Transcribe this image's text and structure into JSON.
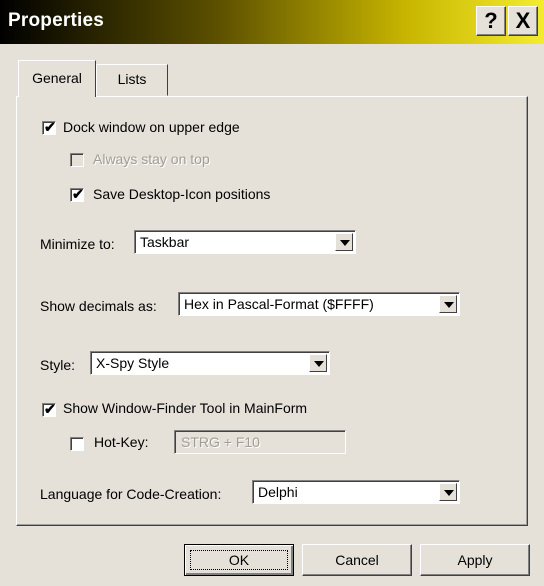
{
  "window": {
    "title": "Properties",
    "help_label": "?",
    "close_label": "X"
  },
  "tabs": [
    {
      "label": "General",
      "active": true
    },
    {
      "label": "Lists",
      "active": false
    }
  ],
  "general": {
    "dock_window": {
      "label": "Dock window on upper edge",
      "checked": true,
      "enabled": true
    },
    "always_on_top": {
      "label": "Always stay on top",
      "checked": false,
      "enabled": false
    },
    "save_icons": {
      "label": "Save Desktop-Icon positions",
      "checked": true,
      "enabled": true
    },
    "minimize_to": {
      "label": "Minimize to:",
      "value": "Taskbar"
    },
    "show_decimals": {
      "label": "Show decimals as:",
      "value": "Hex in Pascal-Format ($FFFF)"
    },
    "style": {
      "label": "Style:",
      "value": "X-Spy Style"
    },
    "show_finder": {
      "label": "Show Window-Finder Tool in MainForm",
      "checked": true,
      "enabled": true
    },
    "hotkey": {
      "label": "Hot-Key:",
      "checked": false,
      "enabled": true,
      "value": "STRG + F10"
    },
    "language": {
      "label": "Language for Code-Creation:",
      "value": "Delphi"
    }
  },
  "buttons": {
    "ok_label": "OK",
    "cancel_label": "Cancel",
    "apply_label": "Apply"
  },
  "check_mark": "✔"
}
